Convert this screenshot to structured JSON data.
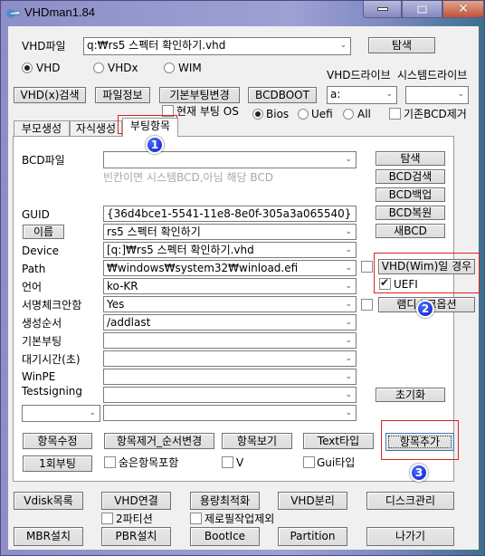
{
  "window": {
    "title": "VHDman1.84",
    "controls": {
      "minimize": "minimize",
      "maximize": "maximize",
      "close": "close"
    }
  },
  "top": {
    "vhd_file_label": "VHD파일",
    "vhd_file_value": "q:₩rs5 스펙터 확인하기.vhd",
    "browse_label": "탐색",
    "format_options": [
      {
        "label": "VHD",
        "selected": true
      },
      {
        "label": "VHDx",
        "selected": false
      },
      {
        "label": "WIM",
        "selected": false
      }
    ],
    "vhd_drive_label": "VHD드라이브",
    "system_drive_label": "시스템드라이브",
    "buttons": {
      "search": "VHD(x)검색",
      "file_info": "파일정보",
      "default_boot_change": "기본부팅변경",
      "bcdboot": "BCDBOOT"
    },
    "vhd_drive_value": "a:",
    "system_drive_value": "",
    "current_boot_os_label": "현재 부팅 OS",
    "current_boot_os_checked": false,
    "firmware_options": [
      {
        "label": "Bios",
        "selected": true
      },
      {
        "label": "Uefi",
        "selected": false
      },
      {
        "label": "All",
        "selected": false
      }
    ],
    "remove_existing_bcd_label": "기존BCD제거",
    "remove_existing_bcd_checked": false
  },
  "tabs": [
    {
      "label": "부모생성",
      "active": false
    },
    {
      "label": "자식생성",
      "active": false
    },
    {
      "label": "부팅항목",
      "active": true
    }
  ],
  "boot_tab": {
    "bcd_file_label": "BCD파일",
    "bcd_file_value": "",
    "bcd_hint": "빈칸이면 시스템BCD,아님 해당 BCD",
    "right_buttons": {
      "browse": "탐색",
      "bcd_search": "BCD검색",
      "bcd_backup": "BCD백업",
      "bcd_restore": "BCD복원",
      "new_bcd": "새BCD",
      "vhd_wim_case": "VHD(Wim)일 경우",
      "ramdisk_option": "램디스크옵션",
      "reset": "초기화"
    },
    "uefi_label": "UEFI",
    "uefi_checked": true,
    "vhd_wim_checked": false,
    "ramdisk_checked": false,
    "fields": [
      {
        "label": "GUID",
        "value": "{36d4bce1-5541-11e8-8e0f-305a3a065540}",
        "is_button": false
      },
      {
        "label": "이름",
        "value": "rs5 스펙터 확인하기",
        "is_button": true
      },
      {
        "label": "Device",
        "value": "[q:]₩rs5 스펙터 확인하기.vhd",
        "is_button": false
      },
      {
        "label": "Path",
        "value": "₩windows₩system32₩winload.efi",
        "is_button": false
      },
      {
        "label": "언어",
        "value": "ko-KR",
        "is_button": false
      },
      {
        "label": "서명체크안함",
        "value": "Yes",
        "is_button": false
      },
      {
        "label": "생성순서",
        "value": "/addlast",
        "is_button": false
      },
      {
        "label": "기본부팅",
        "value": "",
        "is_button": false
      },
      {
        "label": "대기시간(초)",
        "value": "",
        "is_button": false
      },
      {
        "label": "WinPE",
        "value": "",
        "is_button": false
      },
      {
        "label": "Testsigning",
        "value": "",
        "is_button": false
      }
    ],
    "extra_key_value": "",
    "extra_value": "",
    "action_buttons": {
      "edit": "항목수정",
      "remove_reorder": "항목제거_순서변경",
      "view": "항목보기",
      "text_type": "Text타입",
      "add": "항목추가",
      "one_time_boot": "1회부팅"
    },
    "include_hidden_label": "숨은항목포함",
    "include_hidden_checked": false,
    "v_label": "V",
    "v_checked": false,
    "gui_type_label": "Gui타입",
    "gui_type_checked": false
  },
  "bottom": {
    "row1": [
      "Vdisk목록",
      "VHD연결",
      "용량최적화",
      "VHD분리",
      "디스크관리"
    ],
    "two_partition_label": "2파티션",
    "two_partition_checked": false,
    "exclude_zerofill_label": "제로필작업제외",
    "exclude_zerofill_checked": false,
    "row2": [
      "MBR설치",
      "PBR설치",
      "BootIce",
      "Partition",
      "나가기"
    ]
  },
  "annotations": [
    {
      "number": "1"
    },
    {
      "number": "2"
    },
    {
      "number": "3"
    }
  ],
  "colors": {
    "highlight": "#e02020",
    "badge": "#1030e0",
    "titlebar": "#9ea0d4"
  }
}
